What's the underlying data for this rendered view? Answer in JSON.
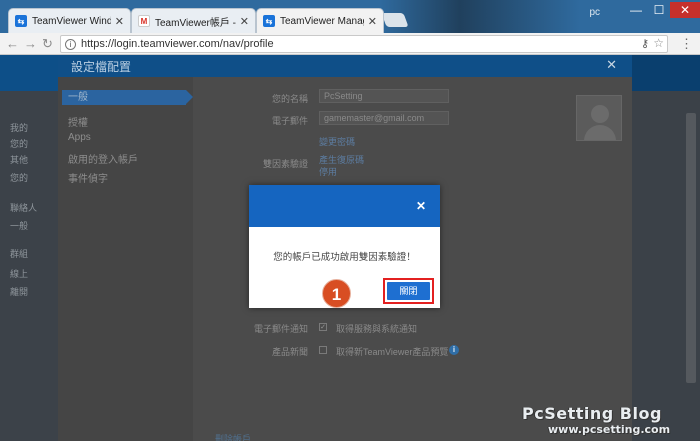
{
  "browser": {
    "tabs": [
      {
        "title": "TeamViewer Windows...",
        "favicon": "teamviewer-icon",
        "active": false
      },
      {
        "title": "TeamViewer帳戶 - 電子...",
        "favicon": "gmail-icon",
        "active": false
      },
      {
        "title": "TeamViewer Management...",
        "favicon": "teamviewer-icon",
        "active": true
      }
    ],
    "user_label": "pc",
    "url": "https://login.teamviewer.com/nav/profile"
  },
  "settings": {
    "title": "設定檔配置",
    "nav": [
      "一般",
      "授權",
      "Apps",
      "啟用的登入帳戶",
      "事件偵字"
    ],
    "fields": {
      "name_label": "您的名稱",
      "name_value": "PcSetting",
      "email_label": "電子郵件",
      "email_value": "gamemaster@gmail.com",
      "change_email": "變更密碼",
      "twofa_label": "雙因素驗證",
      "twofa_link1": "產生復原碼",
      "twofa_link2": "停用",
      "notify_label": "電子郵件通知",
      "notify_text": "取得服務與系統通知",
      "product_label": "產品新聞",
      "product_text": "取得新TeamViewer產品預覽"
    },
    "side_text": [
      "我的",
      "您的",
      "其他",
      "您的",
      "聯絡人",
      "一般",
      "群組",
      "線上",
      "離開"
    ],
    "bottom_link": "刪除帳戶"
  },
  "dialog": {
    "message": "您的帳戶已成功啟用雙因素驗證！",
    "close_label": "關閉",
    "step_number": "1"
  },
  "watermark": {
    "line1": "PcSetting Blog",
    "line2": "www.pcsetting.com"
  },
  "colors": {
    "dialog_header": "#1565c0",
    "button": "#1e6fd1",
    "highlight_border": "#e32020",
    "step_marker": "#d84e23"
  }
}
